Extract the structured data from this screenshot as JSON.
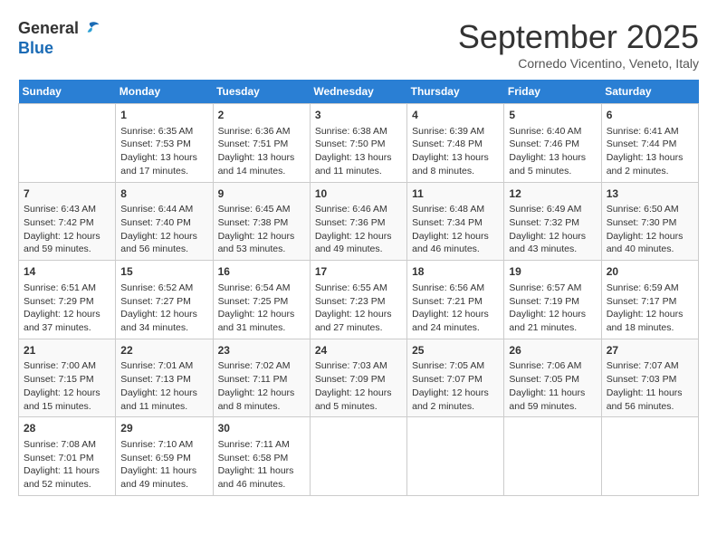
{
  "logo": {
    "text_general": "General",
    "text_blue": "Blue"
  },
  "title": "September 2025",
  "location": "Cornedo Vicentino, Veneto, Italy",
  "days_of_week": [
    "Sunday",
    "Monday",
    "Tuesday",
    "Wednesday",
    "Thursday",
    "Friday",
    "Saturday"
  ],
  "weeks": [
    [
      {
        "day": "",
        "info": ""
      },
      {
        "day": "1",
        "info": "Sunrise: 6:35 AM\nSunset: 7:53 PM\nDaylight: 13 hours\nand 17 minutes."
      },
      {
        "day": "2",
        "info": "Sunrise: 6:36 AM\nSunset: 7:51 PM\nDaylight: 13 hours\nand 14 minutes."
      },
      {
        "day": "3",
        "info": "Sunrise: 6:38 AM\nSunset: 7:50 PM\nDaylight: 13 hours\nand 11 minutes."
      },
      {
        "day": "4",
        "info": "Sunrise: 6:39 AM\nSunset: 7:48 PM\nDaylight: 13 hours\nand 8 minutes."
      },
      {
        "day": "5",
        "info": "Sunrise: 6:40 AM\nSunset: 7:46 PM\nDaylight: 13 hours\nand 5 minutes."
      },
      {
        "day": "6",
        "info": "Sunrise: 6:41 AM\nSunset: 7:44 PM\nDaylight: 13 hours\nand 2 minutes."
      }
    ],
    [
      {
        "day": "7",
        "info": "Sunrise: 6:43 AM\nSunset: 7:42 PM\nDaylight: 12 hours\nand 59 minutes."
      },
      {
        "day": "8",
        "info": "Sunrise: 6:44 AM\nSunset: 7:40 PM\nDaylight: 12 hours\nand 56 minutes."
      },
      {
        "day": "9",
        "info": "Sunrise: 6:45 AM\nSunset: 7:38 PM\nDaylight: 12 hours\nand 53 minutes."
      },
      {
        "day": "10",
        "info": "Sunrise: 6:46 AM\nSunset: 7:36 PM\nDaylight: 12 hours\nand 49 minutes."
      },
      {
        "day": "11",
        "info": "Sunrise: 6:48 AM\nSunset: 7:34 PM\nDaylight: 12 hours\nand 46 minutes."
      },
      {
        "day": "12",
        "info": "Sunrise: 6:49 AM\nSunset: 7:32 PM\nDaylight: 12 hours\nand 43 minutes."
      },
      {
        "day": "13",
        "info": "Sunrise: 6:50 AM\nSunset: 7:30 PM\nDaylight: 12 hours\nand 40 minutes."
      }
    ],
    [
      {
        "day": "14",
        "info": "Sunrise: 6:51 AM\nSunset: 7:29 PM\nDaylight: 12 hours\nand 37 minutes."
      },
      {
        "day": "15",
        "info": "Sunrise: 6:52 AM\nSunset: 7:27 PM\nDaylight: 12 hours\nand 34 minutes."
      },
      {
        "day": "16",
        "info": "Sunrise: 6:54 AM\nSunset: 7:25 PM\nDaylight: 12 hours\nand 31 minutes."
      },
      {
        "day": "17",
        "info": "Sunrise: 6:55 AM\nSunset: 7:23 PM\nDaylight: 12 hours\nand 27 minutes."
      },
      {
        "day": "18",
        "info": "Sunrise: 6:56 AM\nSunset: 7:21 PM\nDaylight: 12 hours\nand 24 minutes."
      },
      {
        "day": "19",
        "info": "Sunrise: 6:57 AM\nSunset: 7:19 PM\nDaylight: 12 hours\nand 21 minutes."
      },
      {
        "day": "20",
        "info": "Sunrise: 6:59 AM\nSunset: 7:17 PM\nDaylight: 12 hours\nand 18 minutes."
      }
    ],
    [
      {
        "day": "21",
        "info": "Sunrise: 7:00 AM\nSunset: 7:15 PM\nDaylight: 12 hours\nand 15 minutes."
      },
      {
        "day": "22",
        "info": "Sunrise: 7:01 AM\nSunset: 7:13 PM\nDaylight: 12 hours\nand 11 minutes."
      },
      {
        "day": "23",
        "info": "Sunrise: 7:02 AM\nSunset: 7:11 PM\nDaylight: 12 hours\nand 8 minutes."
      },
      {
        "day": "24",
        "info": "Sunrise: 7:03 AM\nSunset: 7:09 PM\nDaylight: 12 hours\nand 5 minutes."
      },
      {
        "day": "25",
        "info": "Sunrise: 7:05 AM\nSunset: 7:07 PM\nDaylight: 12 hours\nand 2 minutes."
      },
      {
        "day": "26",
        "info": "Sunrise: 7:06 AM\nSunset: 7:05 PM\nDaylight: 11 hours\nand 59 minutes."
      },
      {
        "day": "27",
        "info": "Sunrise: 7:07 AM\nSunset: 7:03 PM\nDaylight: 11 hours\nand 56 minutes."
      }
    ],
    [
      {
        "day": "28",
        "info": "Sunrise: 7:08 AM\nSunset: 7:01 PM\nDaylight: 11 hours\nand 52 minutes."
      },
      {
        "day": "29",
        "info": "Sunrise: 7:10 AM\nSunset: 6:59 PM\nDaylight: 11 hours\nand 49 minutes."
      },
      {
        "day": "30",
        "info": "Sunrise: 7:11 AM\nSunset: 6:58 PM\nDaylight: 11 hours\nand 46 minutes."
      },
      {
        "day": "",
        "info": ""
      },
      {
        "day": "",
        "info": ""
      },
      {
        "day": "",
        "info": ""
      },
      {
        "day": "",
        "info": ""
      }
    ]
  ]
}
